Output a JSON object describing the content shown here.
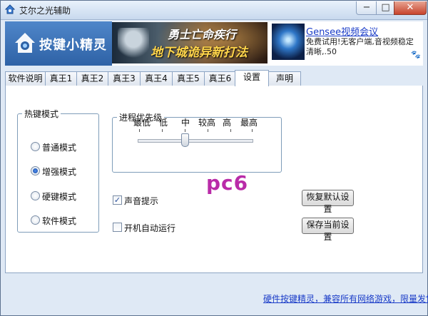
{
  "window": {
    "title": "艾尔之光辅助",
    "controls": {
      "minimize": "−",
      "maximize": "□",
      "close": "✕"
    }
  },
  "banner": {
    "logo_text": "按键小精灵",
    "game_ad": {
      "line1": "勇士亡命疾行",
      "line2": "地下城诡异新打法"
    },
    "gensee": {
      "title": "Gensee视频会议",
      "description": "免费试用!无客户端,音视频稳定清晰,.50",
      "paw": "🐾"
    }
  },
  "tabs": [
    {
      "label": "软件说明",
      "active": false
    },
    {
      "label": "真王1",
      "active": false
    },
    {
      "label": "真王2",
      "active": false
    },
    {
      "label": "真王3",
      "active": false
    },
    {
      "label": "真王4",
      "active": false
    },
    {
      "label": "真王5",
      "active": false
    },
    {
      "label": "真王6",
      "active": false
    },
    {
      "label": "设置",
      "active": true
    },
    {
      "label": "声明",
      "active": false
    }
  ],
  "hotkey_mode": {
    "legend": "热键模式",
    "options": [
      {
        "label": "普通模式",
        "selected": false
      },
      {
        "label": "增强模式",
        "selected": true
      },
      {
        "label": "硬键模式",
        "selected": false
      },
      {
        "label": "软件模式",
        "selected": false
      }
    ]
  },
  "priority": {
    "legend": "进程优先级",
    "levels": [
      "最低",
      "低",
      "中",
      "较高",
      "高",
      "最高"
    ],
    "selected": "中",
    "selected_index": 2
  },
  "options": {
    "sound_prompt": {
      "label": "声音提示",
      "checked": true
    },
    "autostart": {
      "label": "开机自动运行",
      "checked": false
    }
  },
  "buttons": {
    "restore_defaults": "恢复默认设置",
    "save_settings": "保存当前设置"
  },
  "watermark": "pc6",
  "footer": {
    "link_text": "硬件按键精灵，兼容所有网络游戏，限量发售"
  },
  "colors": {
    "link": "#1a3cc8",
    "logo_bg": "#2e62a6",
    "watermark": "#b92ba8",
    "frame": "#dfe9f5"
  }
}
